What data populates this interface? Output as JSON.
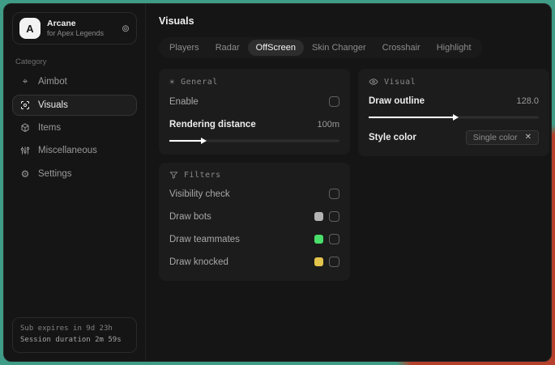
{
  "window": {
    "app_name": "Arcane",
    "app_subtitle": "for Apex Legends",
    "logo_letter": "A"
  },
  "sidebar": {
    "category_label": "Category",
    "items": [
      {
        "label": "Aimbot"
      },
      {
        "label": "Visuals"
      },
      {
        "label": "Items"
      },
      {
        "label": "Miscellaneous"
      },
      {
        "label": "Settings"
      }
    ],
    "footer": {
      "sub_expires": "Sub expires in 9d 23h",
      "session_duration": "Session duration 2m 59s"
    }
  },
  "main": {
    "title": "Visuals",
    "tabs": [
      {
        "label": "Players"
      },
      {
        "label": "Radar"
      },
      {
        "label": "OffScreen"
      },
      {
        "label": "Skin Changer"
      },
      {
        "label": "Crosshair"
      },
      {
        "label": "Highlight"
      }
    ],
    "active_tab": "OffScreen",
    "general_card": {
      "title": "General",
      "enable_label": "Enable",
      "rendering_distance_label": "Rendering distance",
      "rendering_distance_value": "100m",
      "rendering_distance_percent": 19
    },
    "visual_card": {
      "title": "Visual",
      "draw_outline_label": "Draw outline",
      "draw_outline_value": "128.0",
      "draw_outline_percent": 50,
      "style_color_label": "Style color",
      "style_color_value": "Single color"
    },
    "filters_card": {
      "title": "Filters",
      "rows": [
        {
          "label": "Visibility check",
          "swatch": null
        },
        {
          "label": "Draw bots",
          "swatch": "#b4b4b4"
        },
        {
          "label": "Draw teammates",
          "swatch": "#4ade6b"
        },
        {
          "label": "Draw knocked",
          "swatch": "#e3c44c"
        }
      ]
    }
  },
  "colors": {
    "desktop_teal": "#3f9c86",
    "desktop_red": "#b5402c",
    "swatch_gray": "#b4b4b4",
    "swatch_green": "#4ade6b",
    "swatch_yellow": "#e3c44c"
  }
}
